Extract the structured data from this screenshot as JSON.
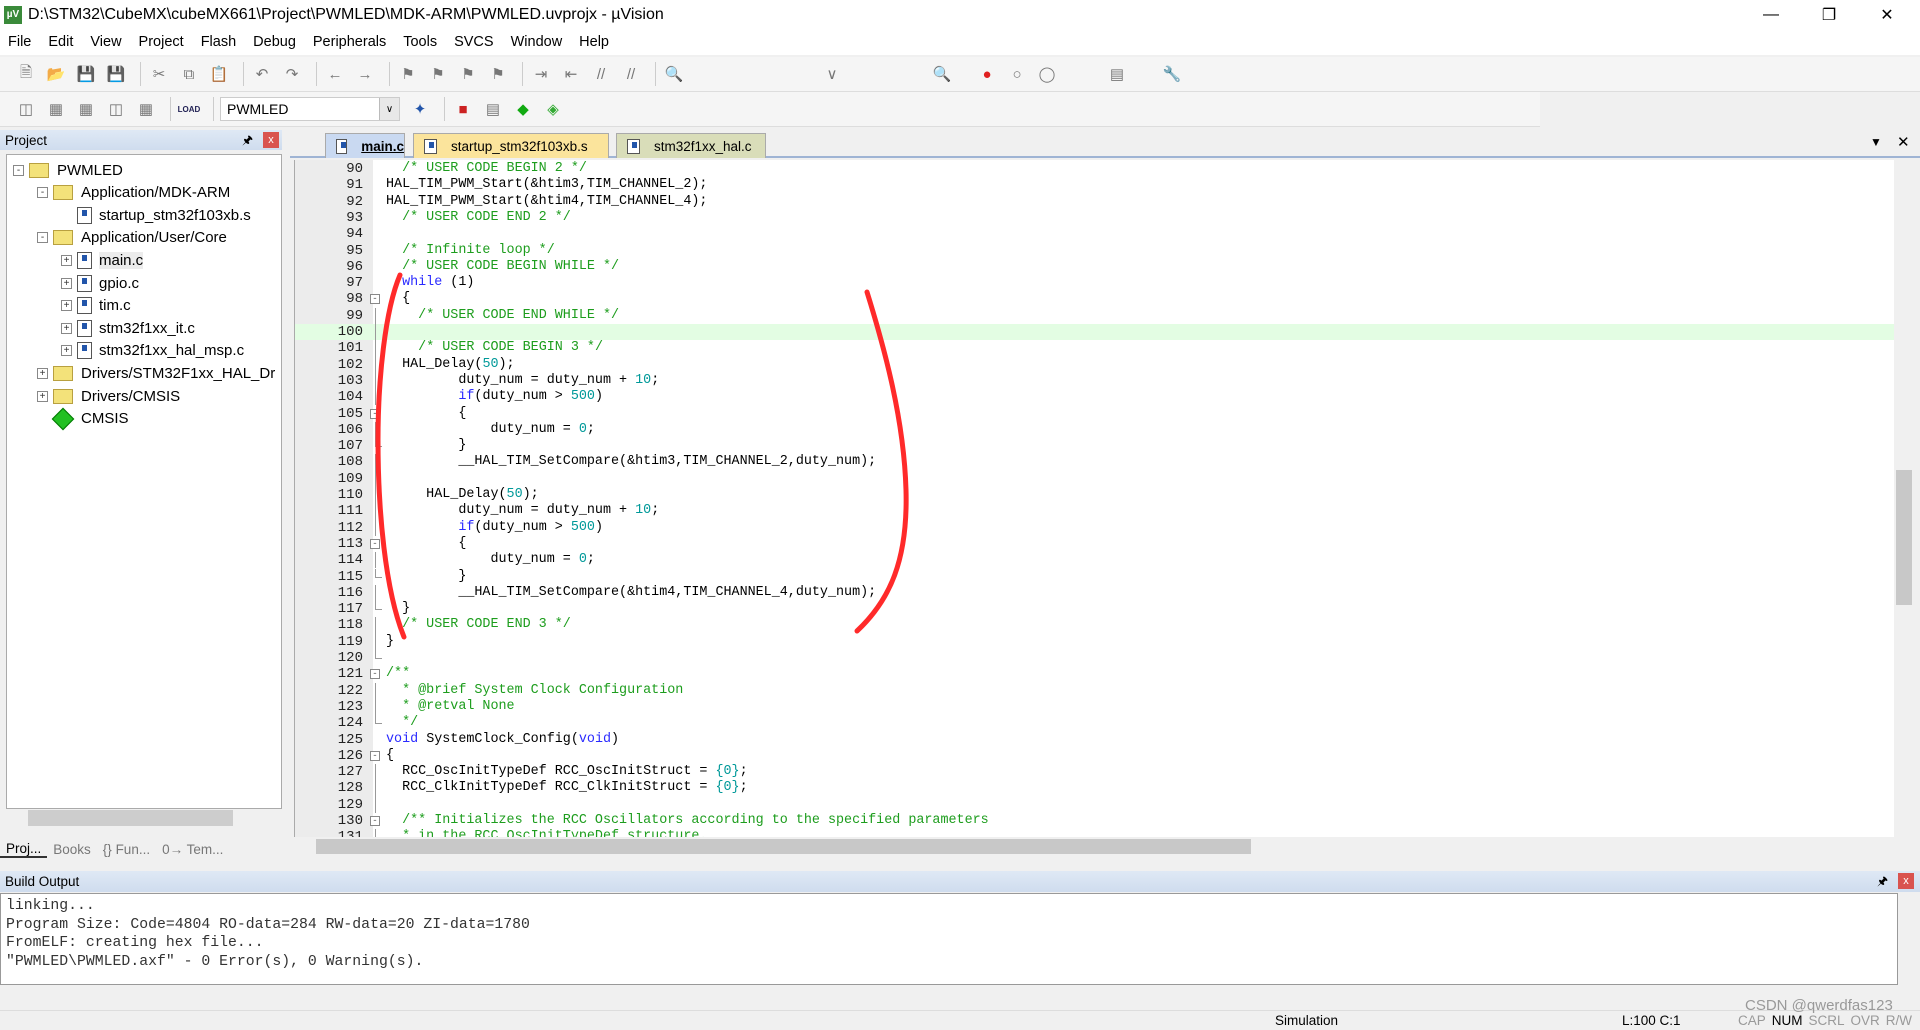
{
  "window": {
    "title": "D:\\STM32\\CubeMX\\cubeMX661\\Project\\PWMLED\\MDK-ARM\\PWMLED.uvprojx - µVision",
    "app_icon": "µV"
  },
  "menu": [
    "File",
    "Edit",
    "View",
    "Project",
    "Flash",
    "Debug",
    "Peripherals",
    "Tools",
    "SVCS",
    "Window",
    "Help"
  ],
  "toolbar1": [
    "new-file",
    "open-file",
    "save",
    "save-all",
    "cut",
    "copy",
    "paste",
    "undo",
    "redo",
    "navigate-back",
    "navigate-forward",
    "bookmark",
    "prev-bookmark",
    "next-bookmark",
    "clear-bookmarks",
    "indent",
    "unindent",
    "comment",
    "uncomment",
    "find-in-files"
  ],
  "toolbar2": {
    "target": "PWMLED",
    "load_label": "LOAD"
  },
  "project_panel": {
    "title": "Project",
    "tree": [
      {
        "label": "PWMLED",
        "level": 0,
        "type": "root",
        "expander": "-"
      },
      {
        "label": "Application/MDK-ARM",
        "level": 1,
        "type": "folder",
        "expander": "-"
      },
      {
        "label": "startup_stm32f103xb.s",
        "level": 2,
        "type": "file",
        "expander": ""
      },
      {
        "label": "Application/User/Core",
        "level": 1,
        "type": "folder",
        "expander": "-"
      },
      {
        "label": "main.c",
        "level": 2,
        "type": "file",
        "expander": "+",
        "selected": true
      },
      {
        "label": "gpio.c",
        "level": 2,
        "type": "file",
        "expander": "+"
      },
      {
        "label": "tim.c",
        "level": 2,
        "type": "file",
        "expander": "+"
      },
      {
        "label": "stm32f1xx_it.c",
        "level": 2,
        "type": "file",
        "expander": "+"
      },
      {
        "label": "stm32f1xx_hal_msp.c",
        "level": 2,
        "type": "file",
        "expander": "+"
      },
      {
        "label": "Drivers/STM32F1xx_HAL_Dr",
        "level": 1,
        "type": "folder",
        "expander": "+"
      },
      {
        "label": "Drivers/CMSIS",
        "level": 1,
        "type": "folder",
        "expander": "+"
      },
      {
        "label": "CMSIS",
        "level": 1,
        "type": "component",
        "expander": ""
      }
    ],
    "tabs": [
      "Proj...",
      "Books",
      "{} Fun...",
      "0→ Tem..."
    ]
  },
  "editor": {
    "tabs": [
      {
        "label": "main.c",
        "active": true,
        "color": "#c9d9f1"
      },
      {
        "label": "startup_stm32f103xb.s",
        "color": "#fbe49c"
      },
      {
        "label": "stm32f1xx_hal.c",
        "color": "#d9ddb9"
      }
    ],
    "current_line": 100,
    "lines": [
      {
        "n": 90,
        "t": [
          [
            "  "
          ],
          [
            "/* USER CODE BEGIN 2 */",
            "c"
          ]
        ]
      },
      {
        "n": 91,
        "t": [
          [
            "HAL_TIM_PWM_Start(&htim3,TIM_CHANNEL_2);"
          ]
        ]
      },
      {
        "n": 92,
        "t": [
          [
            "HAL_TIM_PWM_Start(&htim4,TIM_CHANNEL_4);"
          ]
        ]
      },
      {
        "n": 93,
        "t": [
          [
            "  "
          ],
          [
            "/* USER CODE END 2 */",
            "c"
          ]
        ]
      },
      {
        "n": 94,
        "t": []
      },
      {
        "n": 95,
        "t": [
          [
            "  "
          ],
          [
            "/* Infinite loop */",
            "c"
          ]
        ]
      },
      {
        "n": 96,
        "t": [
          [
            "  "
          ],
          [
            "/* USER CODE BEGIN WHILE */",
            "c"
          ]
        ]
      },
      {
        "n": 97,
        "t": [
          [
            "  "
          ],
          [
            "while",
            "k"
          ],
          [
            " (1)"
          ]
        ]
      },
      {
        "n": 98,
        "fold": "box",
        "t": [
          [
            "  {"
          ]
        ]
      },
      {
        "n": 99,
        "fold": "line",
        "t": [
          [
            "    "
          ],
          [
            "/* USER CODE END WHILE */",
            "c"
          ]
        ]
      },
      {
        "n": 100,
        "fold": "line",
        "t": []
      },
      {
        "n": 101,
        "fold": "line",
        "t": [
          [
            "    "
          ],
          [
            "/* USER CODE BEGIN 3 */",
            "c"
          ]
        ]
      },
      {
        "n": 102,
        "fold": "line",
        "t": [
          [
            "  HAL_Delay("
          ],
          [
            "50",
            "n"
          ],
          [
            ");"
          ]
        ]
      },
      {
        "n": 103,
        "fold": "line",
        "t": [
          [
            "         duty_num = duty_num + "
          ],
          [
            "10",
            "n"
          ],
          [
            ";"
          ]
        ]
      },
      {
        "n": 104,
        "fold": "line",
        "t": [
          [
            "         "
          ],
          [
            "if",
            "k"
          ],
          [
            "(duty_num > "
          ],
          [
            "500",
            "n"
          ],
          [
            ")"
          ]
        ]
      },
      {
        "n": 105,
        "fold": "box",
        "t": [
          [
            "         {"
          ]
        ]
      },
      {
        "n": 106,
        "fold": "line",
        "t": [
          [
            "             duty_num = "
          ],
          [
            "0",
            "n"
          ],
          [
            ";"
          ]
        ]
      },
      {
        "n": 107,
        "fold": "end",
        "t": [
          [
            "         }"
          ]
        ]
      },
      {
        "n": 108,
        "fold": "line",
        "t": [
          [
            "         __HAL_TIM_SetCompare(&htim3,TIM_CHANNEL_2,duty_num);"
          ]
        ]
      },
      {
        "n": 109,
        "fold": "line",
        "t": []
      },
      {
        "n": 110,
        "fold": "line",
        "t": [
          [
            "     HAL_Delay("
          ],
          [
            "50",
            "n"
          ],
          [
            ");"
          ]
        ]
      },
      {
        "n": 111,
        "fold": "line",
        "t": [
          [
            "         duty_num = duty_num + "
          ],
          [
            "10",
            "n"
          ],
          [
            ";"
          ]
        ]
      },
      {
        "n": 112,
        "fold": "line",
        "t": [
          [
            "         "
          ],
          [
            "if",
            "k"
          ],
          [
            "(duty_num > "
          ],
          [
            "500",
            "n"
          ],
          [
            ")"
          ]
        ]
      },
      {
        "n": 113,
        "fold": "box",
        "t": [
          [
            "         {"
          ]
        ]
      },
      {
        "n": 114,
        "fold": "line",
        "t": [
          [
            "             duty_num = "
          ],
          [
            "0",
            "n"
          ],
          [
            ";"
          ]
        ]
      },
      {
        "n": 115,
        "fold": "end",
        "t": [
          [
            "         }"
          ]
        ]
      },
      {
        "n": 116,
        "fold": "line",
        "t": [
          [
            "         __HAL_TIM_SetCompare(&htim4,TIM_CHANNEL_4,duty_num);"
          ]
        ]
      },
      {
        "n": 117,
        "fold": "end",
        "t": [
          [
            "  }"
          ]
        ]
      },
      {
        "n": 118,
        "fold": "line",
        "t": [
          [
            "  "
          ],
          [
            "/* USER CODE END 3 */",
            "c"
          ]
        ]
      },
      {
        "n": 119,
        "fold": "line",
        "t": [
          [
            "}"
          ]
        ]
      },
      {
        "n": 120,
        "fold": "end",
        "t": []
      },
      {
        "n": 121,
        "fold": "box",
        "t": [
          [
            "/**",
            "c"
          ]
        ]
      },
      {
        "n": 122,
        "fold": "line",
        "t": [
          [
            "  "
          ],
          [
            "* @brief System Clock Configuration",
            "c"
          ]
        ]
      },
      {
        "n": 123,
        "fold": "line",
        "t": [
          [
            "  "
          ],
          [
            "* @retval None",
            "c"
          ]
        ]
      },
      {
        "n": 124,
        "fold": "end",
        "t": [
          [
            "  "
          ],
          [
            "*/",
            "c"
          ]
        ]
      },
      {
        "n": 125,
        "t": [
          [
            "void",
            "k"
          ],
          [
            " SystemClock_Config("
          ],
          [
            "void",
            "k"
          ],
          [
            ")"
          ]
        ]
      },
      {
        "n": 126,
        "fold": "box",
        "t": [
          [
            "{"
          ]
        ]
      },
      {
        "n": 127,
        "fold": "line",
        "t": [
          [
            "  RCC_OscInitTypeDef RCC_OscInitStruct = "
          ],
          [
            "{0}",
            "n"
          ],
          [
            ";"
          ]
        ]
      },
      {
        "n": 128,
        "fold": "line",
        "t": [
          [
            "  RCC_ClkInitTypeDef RCC_ClkInitStruct = "
          ],
          [
            "{0}",
            "n"
          ],
          [
            ";"
          ]
        ]
      },
      {
        "n": 129,
        "fold": "line",
        "t": []
      },
      {
        "n": 130,
        "fold": "box",
        "t": [
          [
            "  "
          ],
          [
            "/** Initializes the RCC Oscillators according to the specified parameters",
            "c"
          ]
        ]
      },
      {
        "n": 131,
        "fold": "line",
        "t": [
          [
            "  "
          ],
          [
            "* in the RCC_OscInitTypeDef structure.",
            "c"
          ]
        ]
      }
    ],
    "annotation_color": "#ff2a2a"
  },
  "build_output": {
    "title": "Build Output",
    "lines": [
      "linking...",
      "Program Size: Code=4804 RO-data=284 RW-data=20 ZI-data=1780",
      "FromELF: creating hex file...",
      "\"PWMLED\\PWMLED.axf\" - 0 Error(s), 0 Warning(s)."
    ]
  },
  "status": {
    "mode": "Simulation",
    "position": "L:100 C:1",
    "indicators": [
      "CAP",
      "NUM",
      "SCRL",
      "OVR",
      "R/W"
    ],
    "watermark": "CSDN @qwerdfas123"
  }
}
